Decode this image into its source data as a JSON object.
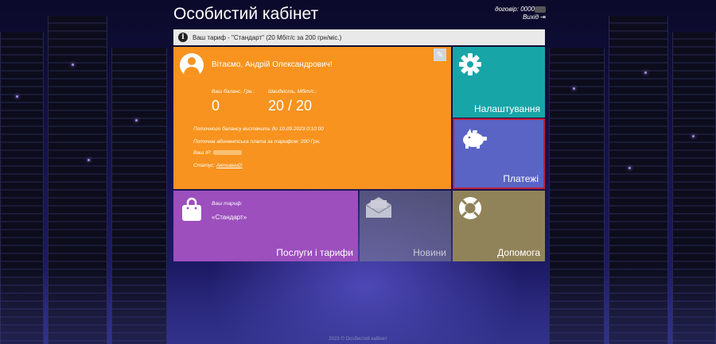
{
  "header": {
    "title": "Особистий кабінет",
    "contract_label": "договір: 0000",
    "logout_label": "Вихід"
  },
  "info_bar": {
    "text": "Ваш тариф - \"Стандарт\" (20 Мбіт/с за 200 грн/міс.)"
  },
  "main_tile": {
    "greeting": "Вітаємо, Андрій Олександрович!",
    "balance_label": "Ваш баланс, Грн.:",
    "balance_value": "0",
    "speed_label": "Швидкість, Мбіт/с.:",
    "speed_value": "20 / 20",
    "balance_line": "Поточного балансу вистачить до 10.09.2023 0:10:00",
    "fee_line": "Поточна абонентська плата за тарифом: 200 Грн.",
    "ip_label": "Ваш IP:",
    "status_label": "Статус:",
    "status_value": "Активний!"
  },
  "tiles": {
    "settings": "Налаштування",
    "payments": "Платежі",
    "services": "Послуги і тарифи",
    "services_tariff_label": "Ваш тариф:",
    "services_tariff_name": "«Стандарт»",
    "news": "Новини",
    "help": "Допомога"
  },
  "colors": {
    "main": "#f7931e",
    "settings": "#17a5a8",
    "payments": "#5a64c4",
    "services": "#9c4fbd",
    "help": "#918359",
    "selected_border": "#c0203a"
  },
  "icons": {
    "avatar": "user-avatar-icon",
    "edit": "edit-icon",
    "info": "info-icon",
    "settings": "gear-icon",
    "payments": "piggy-bank-icon",
    "services": "shopping-bag-icon",
    "news": "envelope-icon",
    "help": "lifebuoy-icon",
    "logout": "logout-icon"
  },
  "footer": {
    "text": "2023 © Особистий кабінет"
  }
}
